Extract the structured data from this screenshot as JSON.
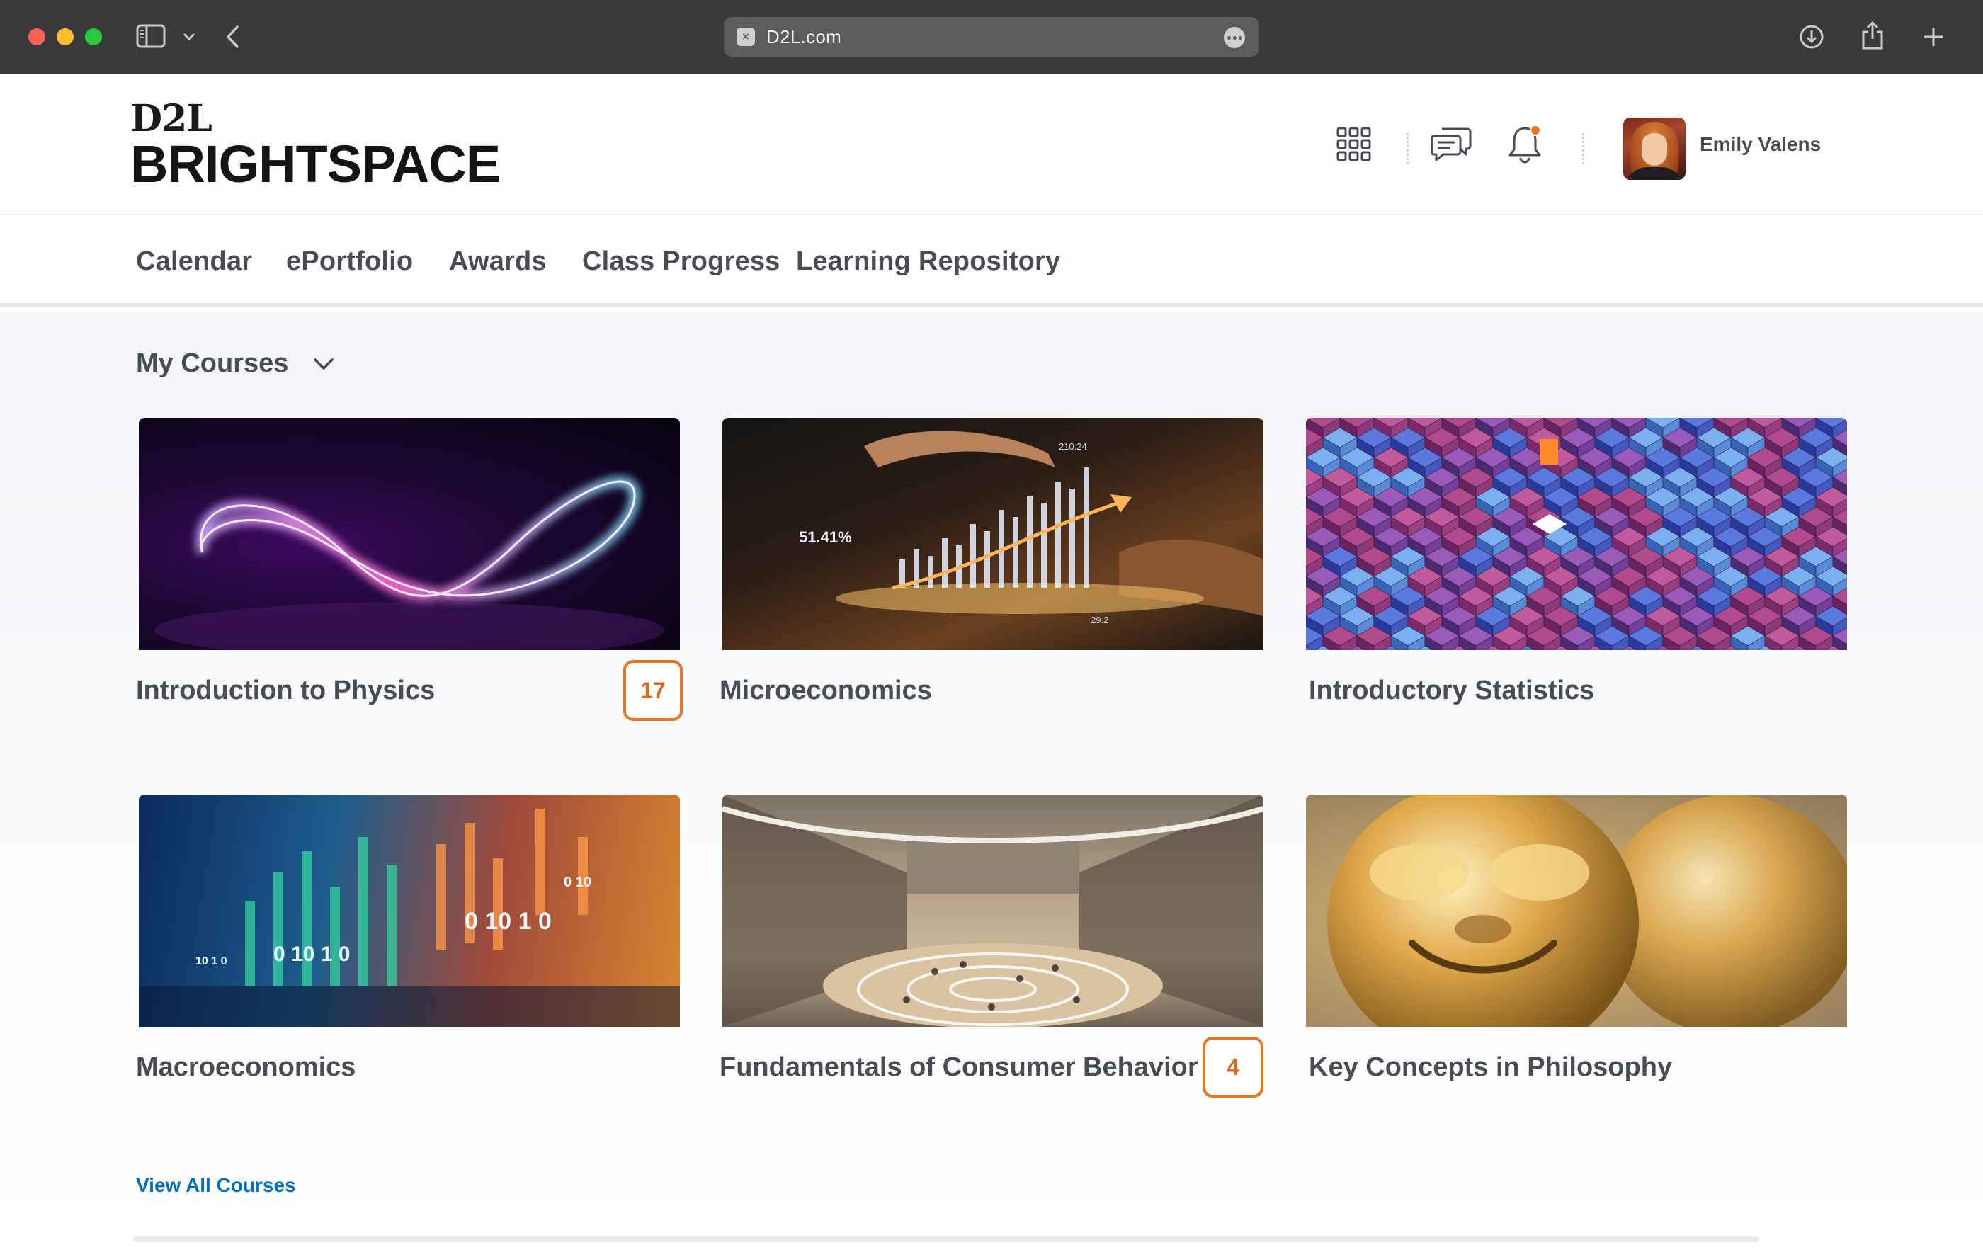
{
  "browser": {
    "url": "D2L.com",
    "favicon_glyph": "×"
  },
  "header": {
    "logo_top": "D2L",
    "logo_bottom": "BRIGHTSPACE",
    "user_name": "Emily Valens",
    "accent_color": "#e87722"
  },
  "nav": {
    "items": [
      "Calendar",
      "ePortfolio",
      "Awards",
      "Class Progress",
      "Learning Repository"
    ]
  },
  "courses_widget": {
    "title": "My Courses",
    "view_all": "View All Courses",
    "cards": [
      {
        "name": "Introduction to Physics",
        "badge": "17",
        "image": "neon-infinity-light"
      },
      {
        "name": "Microeconomics",
        "badge": "",
        "image": "hand-over-growth-chart"
      },
      {
        "name": "Introductory Statistics",
        "badge": "",
        "image": "purple-blue-cubes"
      },
      {
        "name": "Macroeconomics",
        "badge": "",
        "image": "stock-chart-numbers"
      },
      {
        "name": "Fundamentals of Consumer Behavior",
        "badge": "4",
        "image": "shopping-mall-crowd"
      },
      {
        "name": "Key Concepts in Philosophy",
        "badge": "",
        "image": "golden-monkey-statues"
      }
    ]
  }
}
